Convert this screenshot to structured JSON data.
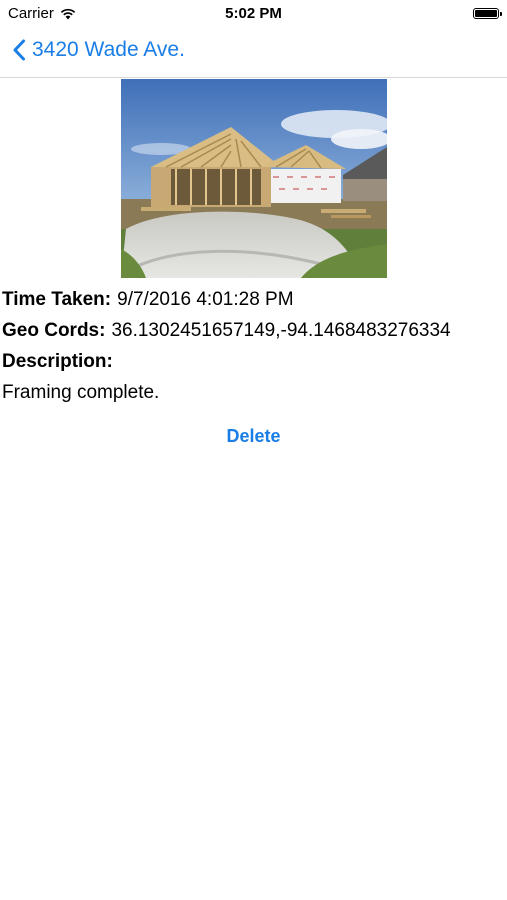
{
  "status_bar": {
    "carrier": "Carrier",
    "time": "5:02 PM",
    "icons": [
      "wifi-icon",
      "battery-icon"
    ]
  },
  "nav": {
    "back_label": "3420 Wade Ave.",
    "back_icon": "chevron-left-icon",
    "accent_color": "#1a7ee6"
  },
  "photo": {
    "subject": "house-framing-photo"
  },
  "details": {
    "time_taken_label": "Time Taken:",
    "time_taken_value": "9/7/2016 4:01:28 PM",
    "geo_label": "Geo Cords:",
    "geo_value": "36.1302451657149,-94.1468483276334",
    "description_label": "Description:",
    "description_value": "Framing complete."
  },
  "actions": {
    "delete_label": "Delete"
  }
}
